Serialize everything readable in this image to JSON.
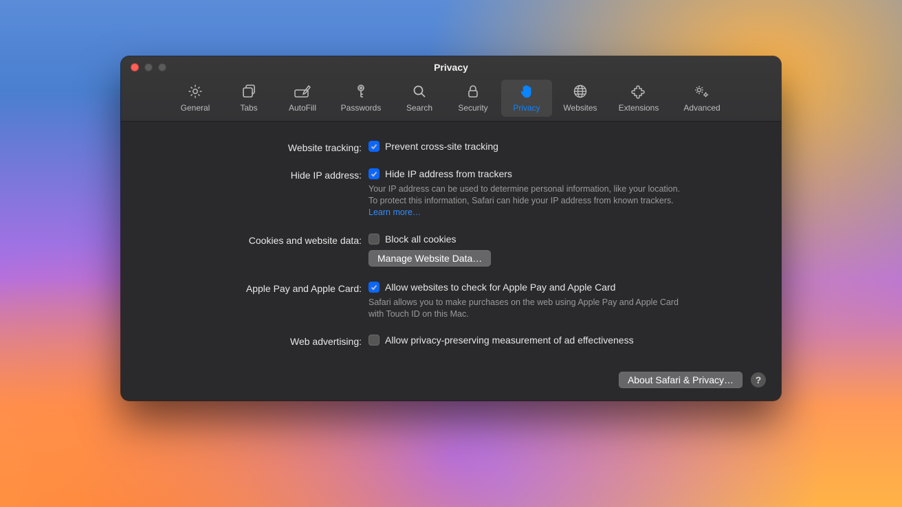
{
  "window": {
    "title": "Privacy"
  },
  "toolbar": {
    "tabs": [
      {
        "label": "General"
      },
      {
        "label": "Tabs"
      },
      {
        "label": "AutoFill"
      },
      {
        "label": "Passwords"
      },
      {
        "label": "Search"
      },
      {
        "label": "Security"
      },
      {
        "label": "Privacy"
      },
      {
        "label": "Websites"
      },
      {
        "label": "Extensions"
      },
      {
        "label": "Advanced"
      }
    ],
    "active_index": 6
  },
  "sections": {
    "website_tracking": {
      "label": "Website tracking:",
      "checkbox_label": "Prevent cross-site tracking",
      "checked": true
    },
    "hide_ip": {
      "label": "Hide IP address:",
      "checkbox_label": "Hide IP address from trackers",
      "checked": true,
      "desc": "Your IP address can be used to determine personal information, like your location. To protect this information, Safari can hide your IP address from known trackers.",
      "learn_more": "Learn more…"
    },
    "cookies": {
      "label": "Cookies and website data:",
      "checkbox_label": "Block all cookies",
      "checked": false,
      "manage_button": "Manage Website Data…"
    },
    "apple_pay": {
      "label": "Apple Pay and Apple Card:",
      "checkbox_label": "Allow websites to check for Apple Pay and Apple Card",
      "checked": true,
      "desc": "Safari allows you to make purchases on the web using Apple Pay and Apple Card with Touch ID on this Mac."
    },
    "web_advertising": {
      "label": "Web advertising:",
      "checkbox_label": "Allow privacy-preserving measurement of ad effectiveness",
      "checked": false
    }
  },
  "footer": {
    "about_button": "About Safari & Privacy…",
    "help": "?"
  }
}
